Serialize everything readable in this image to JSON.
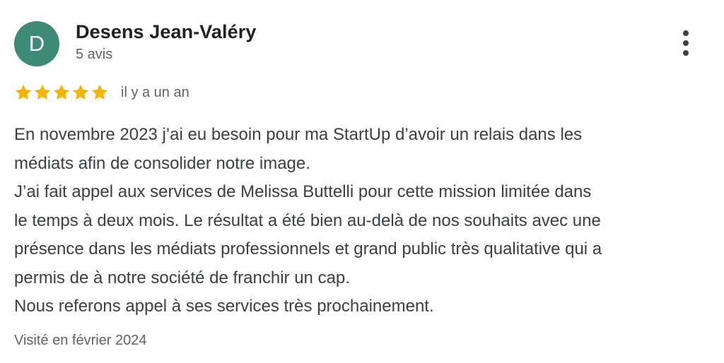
{
  "review": {
    "avatar_initial": "D",
    "avatar_color": "#3d8a77",
    "author_name": "Desens Jean-Valéry",
    "review_count": "5 avis",
    "more_icon": "more-vert-icon",
    "rating": 5,
    "rating_max": 5,
    "star_color": "#f4b400",
    "relative_date": "il y a un an",
    "text_lines": [
      "En novembre 2023 j’ai eu besoin pour ma StartUp d’avoir un relais dans les",
      "médiats afin de consolider notre image.",
      "J’ai fait appel aux services de Melissa Buttelli pour cette mission limitée dans",
      "le temps à deux mois. Le résultat a été bien au-delà de nos souhaits avec une",
      "présence dans les médiats professionnels et grand public très qualitative qui a",
      "permis de à notre société de franchir un cap.",
      "Nous referons appel à ses services très prochainement."
    ],
    "visit_date": "Visité en février 2024"
  }
}
